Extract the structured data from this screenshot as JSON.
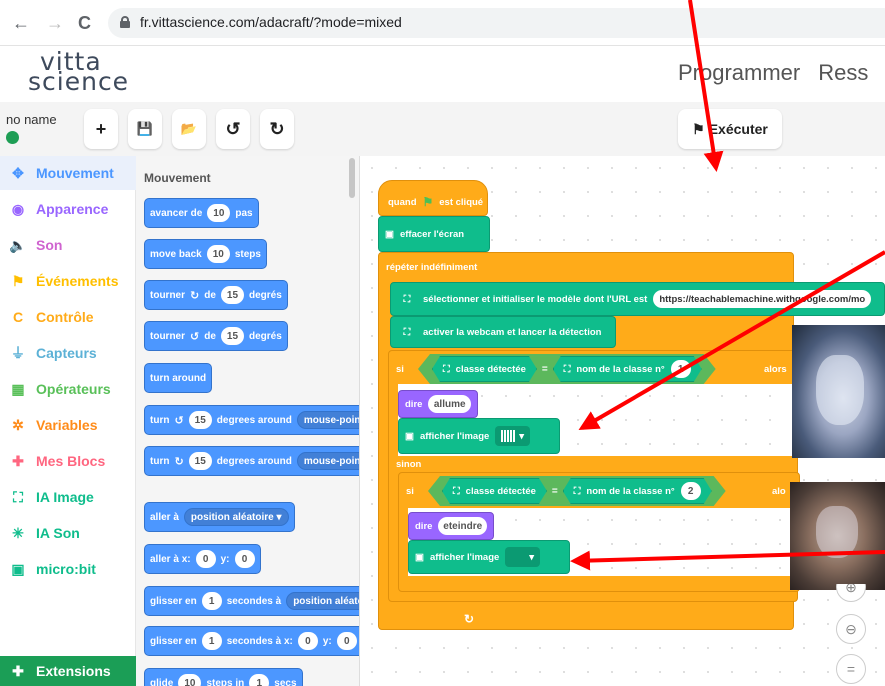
{
  "browser": {
    "url": "fr.vittascience.com/adacraft/?mode=mixed",
    "back_icon": "←",
    "forward_icon": "→",
    "reload_icon": "C"
  },
  "app": {
    "logo_line1": "vitta",
    "logo_line2": "science",
    "nav": [
      "Programmer",
      "Ress"
    ]
  },
  "toolbar": {
    "project_name": "no name",
    "new_label": "+",
    "save_label": "💾",
    "open_label": "📂",
    "undo_label": "↺",
    "redo_label": "↻",
    "run_label": "Exécuter"
  },
  "categories": [
    {
      "label": "Mouvement",
      "icon": "✥",
      "color": "#4c97ff"
    },
    {
      "label": "Apparence",
      "icon": "◉",
      "color": "#9966ff"
    },
    {
      "label": "Son",
      "icon": "🔈",
      "color": "#cf63cf"
    },
    {
      "label": "Événements",
      "icon": "⚑",
      "color": "#ffbf00"
    },
    {
      "label": "Contrôle",
      "icon": "C",
      "color": "#ffab19"
    },
    {
      "label": "Capteurs",
      "icon": "⏚",
      "color": "#5cb1d6"
    },
    {
      "label": "Opérateurs",
      "icon": "▦",
      "color": "#59c059"
    },
    {
      "label": "Variables",
      "icon": "✲",
      "color": "#ff8c1a"
    },
    {
      "label": "Mes Blocs",
      "icon": "✚",
      "color": "#ff6680"
    },
    {
      "label": "IA Image",
      "icon": "⛶",
      "color": "#0fbd8c"
    },
    {
      "label": "IA Son",
      "icon": "✳",
      "color": "#0fbd8c"
    },
    {
      "label": "micro:bit",
      "icon": "▣",
      "color": "#0fbd8c"
    }
  ],
  "extensions_label": "Extensions",
  "flyout": {
    "title": "Mouvement",
    "b1": {
      "a": "avancer de",
      "v": "10",
      "b": "pas"
    },
    "b2": {
      "a": "move back",
      "v": "10",
      "b": "steps"
    },
    "b3": {
      "a": "tourner",
      "v": "15",
      "b": "degrés"
    },
    "b4": {
      "a": "tourner",
      "v": "15",
      "b": "degrés"
    },
    "b5": {
      "a": "turn around"
    },
    "b6": {
      "a": "turn",
      "v": "15",
      "b": "degrees around",
      "c": "mouse-poin"
    },
    "b7": {
      "a": "turn",
      "v": "15",
      "b": "degrees around",
      "c": "mouse-poin"
    },
    "b8": {
      "a": "aller à",
      "c": "position aléatoire"
    },
    "b9": {
      "a": "aller à x:",
      "v": "0",
      "b": "y:",
      "v2": "0"
    },
    "b10": {
      "a": "glisser en",
      "v": "1",
      "b": "secondes à",
      "c": "position aléato"
    },
    "b11": {
      "a": "glisser en",
      "v": "1",
      "b": "secondes à x:",
      "v2": "0",
      "d": "y:",
      "v3": "0"
    },
    "b12": {
      "a": "glide",
      "v": "10",
      "b": "steps in",
      "v2": "1",
      "d": "secs"
    },
    "de": "de"
  },
  "script": {
    "hat": "quand",
    "hat_suffix": "est cliqué",
    "clear": "effacer l'écran",
    "forever": "répéter indéfiniment",
    "select_model": "sélectionner et initialiser le modèle dont l'URL est",
    "model_url": "https://teachablemachine.withgoogle.com/mo",
    "webcam": "activer la webcam et lancer la détection",
    "if1": "si",
    "detected1": "classe détectée",
    "eq1": "=",
    "classname1": "nom de la classe n°",
    "n1": "1",
    "then1": "alors",
    "say1": "dire",
    "say1_value": "allume",
    "show1": "afficher l'image",
    "else": "sinon",
    "if2": "si",
    "detected2": "classe détectée",
    "eq2": "=",
    "classname2": "nom de la classe n°",
    "n2": "2",
    "then2": "alo",
    "say2": "dire",
    "say2_value": "eteindre",
    "show2": "afficher l'image"
  },
  "zoom": {
    "zoom_out": "−",
    "reset": "="
  },
  "colors": {
    "annotation_arrow": "#ff0000",
    "events": "#ffbf00",
    "control": "#ffab19",
    "extension": "#0fbd8c"
  }
}
